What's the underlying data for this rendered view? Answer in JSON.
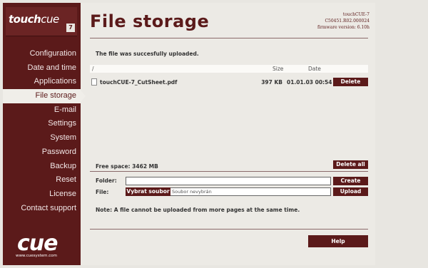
{
  "brand": {
    "logo_main": "touch",
    "logo_suffix": "cue",
    "logo_version": "7",
    "footer_logo": "cue",
    "footer_url": "www.cuesystem.com"
  },
  "sidebar": {
    "items": [
      {
        "label": "Configuration",
        "active": false
      },
      {
        "label": "Date and time",
        "active": false
      },
      {
        "label": "Applications",
        "active": false
      },
      {
        "label": "File storage",
        "active": true
      },
      {
        "label": "E-mail",
        "active": false
      },
      {
        "label": "Settings",
        "active": false
      },
      {
        "label": "System",
        "active": false
      },
      {
        "label": "Password",
        "active": false
      },
      {
        "label": "Backup",
        "active": false
      },
      {
        "label": "Reset",
        "active": false
      },
      {
        "label": "License",
        "active": false
      },
      {
        "label": "Contact support",
        "active": false
      }
    ]
  },
  "header": {
    "title": "File storage",
    "device_name": "touchCUE-7",
    "serial": "C50451.R02.000024",
    "firmware": "firmware version: 6.10h"
  },
  "main": {
    "message": "The file was succesfully uploaded.",
    "path": "/",
    "columns": {
      "size": "Size",
      "date": "Date"
    },
    "files": [
      {
        "name": "touchCUE-7_CutSheet.pdf",
        "size": "397 KB",
        "date": "01.01.03 00:54",
        "action": "Delete"
      }
    ],
    "free_space": "Free space: 3462 MB",
    "delete_all": "Delete all",
    "folder_label": "Folder:",
    "folder_value": "",
    "create_label": "Create",
    "file_label": "File:",
    "choose_file": "Vybrat soubor",
    "no_file": "Soubor nevybrán",
    "upload_label": "Upload",
    "note": "Note: A file cannot be uploaded from more pages at the same time.",
    "help": "Help"
  },
  "colors": {
    "accent": "#5b1a1a",
    "background": "#eceae5"
  }
}
